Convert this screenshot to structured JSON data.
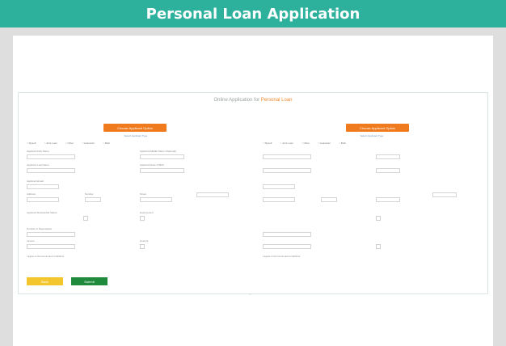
{
  "banner": {
    "title": "Personal Loan Application"
  },
  "app": {
    "heading_plain": "Online Application for ",
    "heading_highlight": "Personal Loan"
  },
  "left": {
    "option_button": "Choose Applicant Option",
    "option_sub": "Select Applicant Type",
    "radios": [
      "Myself",
      "Joint Loan",
      "Other",
      "Guarantor",
      "Both"
    ],
    "fields": [
      {
        "label": "Applicant First Name",
        "value": ""
      },
      {
        "label": "Applicant Middle Name (Optional)",
        "value": ""
      },
      {
        "label": "Applicant Last Name",
        "value": ""
      },
      {
        "label": "Applicant Date of Birth",
        "value": ""
      },
      {
        "label": "Applicant Email",
        "value": ""
      },
      {
        "label": "Address",
        "value": ""
      },
      {
        "label": "Number",
        "value": ""
      },
      {
        "label": "Street",
        "value": ""
      },
      {
        "label": "Postcode",
        "value": ""
      },
      {
        "label": "Applicant Residential Status",
        "value": ""
      },
      {
        "label": "Employment",
        "value": ""
      },
      {
        "label": "Number of Dependants",
        "value": ""
      },
      {
        "label": "Income",
        "value": ""
      },
      {
        "label": "Amount",
        "value": ""
      }
    ],
    "consent": "I agree to the terms and conditions"
  },
  "right": {
    "option_button": "Choose Applicant Option",
    "option_sub": "Select Applicant Type",
    "radios": [
      "Myself",
      "Joint Loan",
      "Other",
      "Guarantor",
      "Both"
    ],
    "consent": "I agree to the terms and conditions"
  },
  "buttons": {
    "back": "Back",
    "submit": "Submit"
  }
}
